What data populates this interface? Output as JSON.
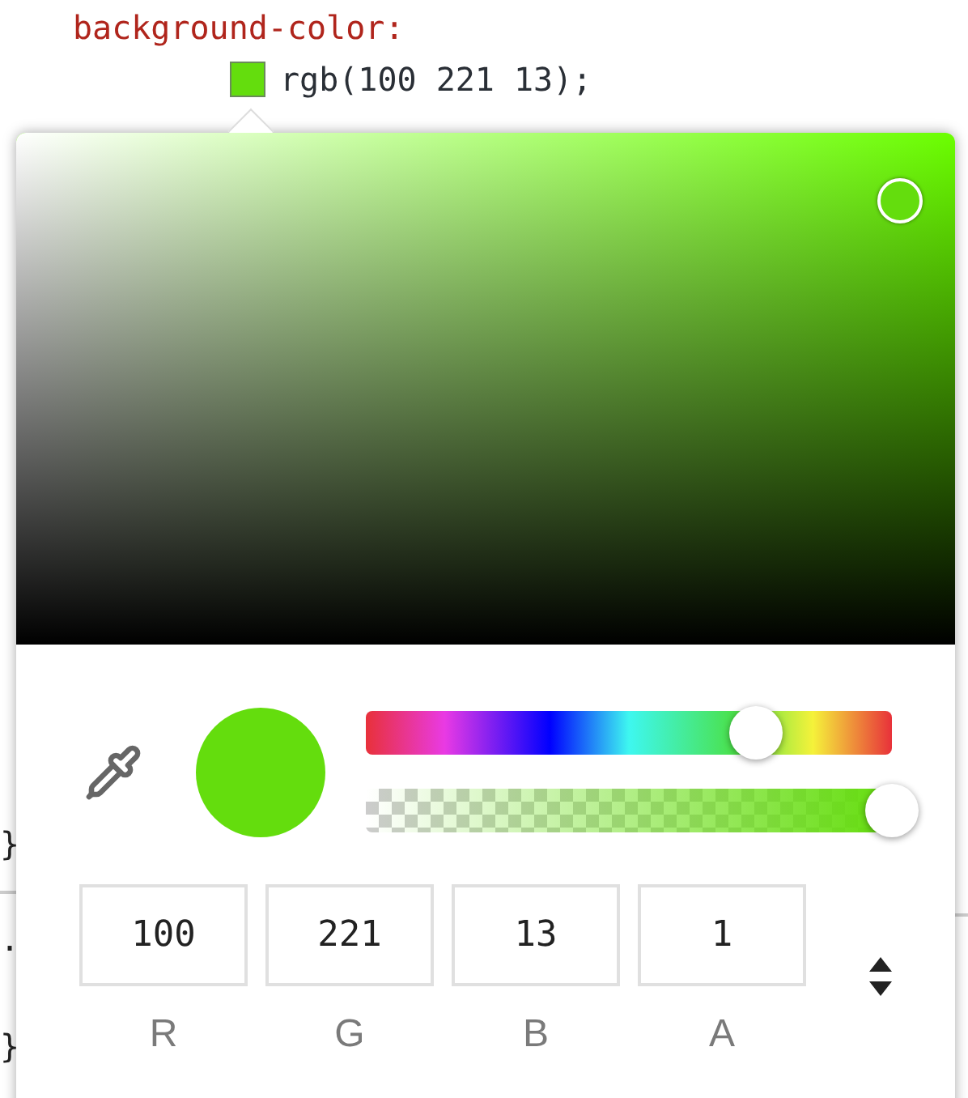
{
  "code": {
    "property": "background-color:",
    "value": "rgb(100 221 13);",
    "left_edge": [
      "}",
      ".",
      "}"
    ]
  },
  "picker": {
    "hue": {
      "level": 0.74
    },
    "alpha": {
      "level": 1
    },
    "channels": [
      {
        "label": "R",
        "value": "100"
      },
      {
        "label": "G",
        "value": "221"
      },
      {
        "label": "B",
        "value": "13"
      },
      {
        "label": "A",
        "value": "1"
      }
    ]
  }
}
